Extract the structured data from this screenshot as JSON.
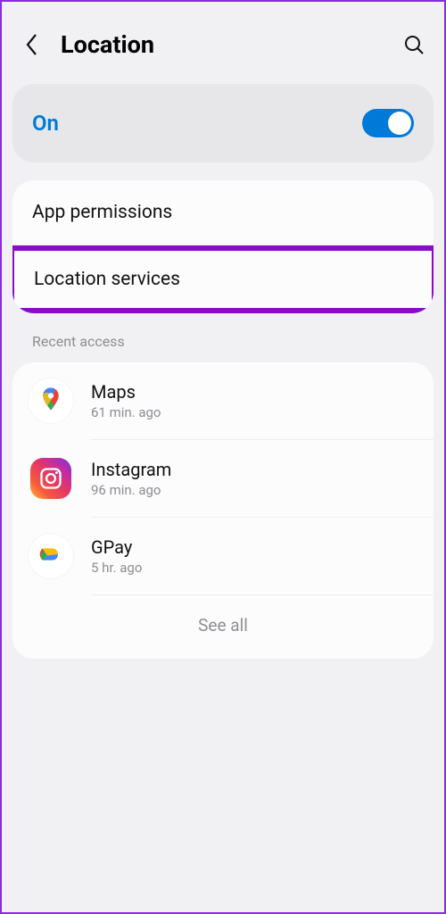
{
  "header": {
    "title": "Location"
  },
  "toggle": {
    "label": "On",
    "state": true
  },
  "menu": {
    "app_permissions": "App permissions",
    "location_services": "Location services"
  },
  "recent": {
    "section_label": "Recent access",
    "items": [
      {
        "name": "Maps",
        "time": "61 min. ago",
        "icon": "maps"
      },
      {
        "name": "Instagram",
        "time": "96 min. ago",
        "icon": "instagram"
      },
      {
        "name": "GPay",
        "time": "5 hr. ago",
        "icon": "gpay"
      }
    ],
    "see_all": "See all"
  }
}
